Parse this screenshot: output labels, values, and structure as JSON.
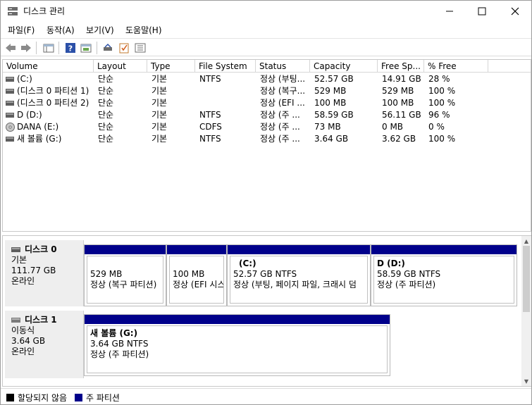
{
  "window": {
    "title": "디스크 관리",
    "min_label": "—",
    "max_label": "☐",
    "close_label": "✕"
  },
  "menu": [
    "파일(F)",
    "동작(A)",
    "보기(V)",
    "도움말(H)"
  ],
  "columns": [
    "Volume",
    "Layout",
    "Type",
    "File System",
    "Status",
    "Capacity",
    "Free Sp...",
    "% Free"
  ],
  "volumes": [
    {
      "volume": "(C:)",
      "layout": "단순",
      "type": "기본",
      "fs": "NTFS",
      "status": "정상 (부팅...",
      "capacity": "52.57 GB",
      "free": "14.91 GB",
      "pct": "28 %",
      "icon": "hard-drive-icon"
    },
    {
      "volume": "(디스크 0 파티션 1)",
      "layout": "단순",
      "type": "기본",
      "fs": "",
      "status": "정상 (복구...",
      "capacity": "529 MB",
      "free": "529 MB",
      "pct": "100 %",
      "icon": "hard-drive-icon"
    },
    {
      "volume": "(디스크 0 파티션 2)",
      "layout": "단순",
      "type": "기본",
      "fs": "",
      "status": "정상 (EFI ...",
      "capacity": "100 MB",
      "free": "100 MB",
      "pct": "100 %",
      "icon": "hard-drive-icon"
    },
    {
      "volume": "D (D:)",
      "layout": "단순",
      "type": "기본",
      "fs": "NTFS",
      "status": "정상 (주 ...",
      "capacity": "58.59 GB",
      "free": "56.11 GB",
      "pct": "96 %",
      "icon": "hard-drive-icon"
    },
    {
      "volume": "DANA (E:)",
      "layout": "단순",
      "type": "기본",
      "fs": "CDFS",
      "status": "정상 (주 ...",
      "capacity": "73 MB",
      "free": "0 MB",
      "pct": "0 %",
      "icon": "cd-drive-icon"
    },
    {
      "volume": "새 볼륨 (G:)",
      "layout": "단순",
      "type": "기본",
      "fs": "NTFS",
      "status": "정상 (주 ...",
      "capacity": "3.64 GB",
      "free": "3.62 GB",
      "pct": "100 %",
      "icon": "hard-drive-icon"
    }
  ],
  "disks": [
    {
      "name": "디스크 0",
      "kind": "기본",
      "size": "111.77 GB",
      "state": "온라인",
      "partitions": [
        {
          "title": "",
          "line1": "529 MB",
          "line2": "정상 (복구 파티션)"
        },
        {
          "title": "",
          "line1": "100 MB",
          "line2": "정상 (EFI 시스"
        },
        {
          "title": "(C:)",
          "line1": "52.57 GB NTFS",
          "line2": "정상 (부팅, 페이지 파일, 크래시 덤"
        },
        {
          "title": "D  (D:)",
          "line1": "58.59 GB NTFS",
          "line2": "정상 (주 파티션)"
        }
      ]
    },
    {
      "name": "디스크 1",
      "kind": "이동식",
      "size": "3.64 GB",
      "state": "온라인",
      "partitions": [
        {
          "title": "새 볼륨  (G:)",
          "line1": "3.64 GB NTFS",
          "line2": "정상 (주 파티션)"
        }
      ]
    }
  ],
  "legend": [
    {
      "label": "할당되지 않음",
      "color": "#000000"
    },
    {
      "label": "주 파티션",
      "color": "#00008b"
    }
  ],
  "colors": {
    "partition_bar": "#00008b",
    "disk_label_bg": "#eeeeee"
  }
}
